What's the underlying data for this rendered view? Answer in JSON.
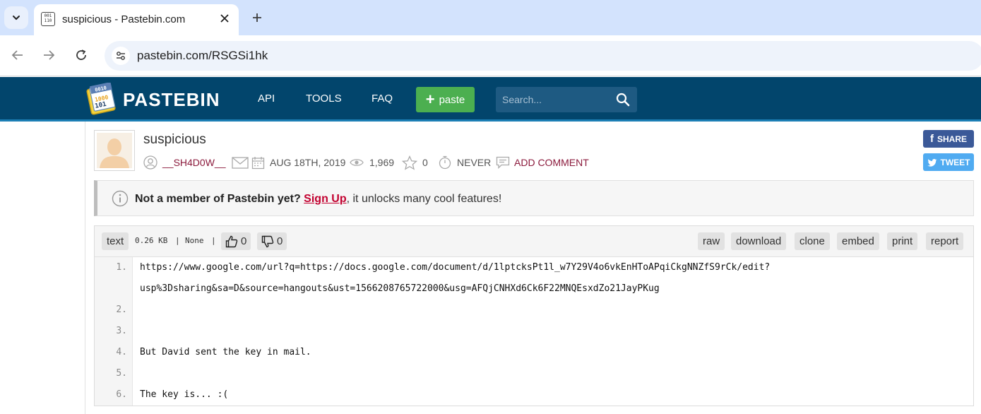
{
  "browser": {
    "tab_title": "suspicious - Pastebin.com",
    "url": "pastebin.com/RSGSi1hk"
  },
  "site": {
    "brand": "PASTEBIN",
    "nav": [
      "API",
      "TOOLS",
      "FAQ"
    ],
    "paste_button": "paste",
    "search_placeholder": "Search...",
    "header_color": "#02456c",
    "accent_green": "#4caf50"
  },
  "paste": {
    "title": "suspicious",
    "author": "__SH4D0W__",
    "date": "AUG 18TH, 2019",
    "views": "1,969",
    "stars": "0",
    "expiry": "NEVER",
    "add_comment": "ADD COMMENT",
    "share_facebook": "SHARE",
    "share_twitter": "TWEET"
  },
  "notice": {
    "lead": "Not a member of Pastebin yet?",
    "signup": "Sign Up",
    "tail": ", it unlocks many cool features!"
  },
  "code_header": {
    "syntax": "text",
    "size": "0.26 KB",
    "sep1": "|",
    "category": "None",
    "sep2": "|",
    "likes": "0",
    "dislikes": "0",
    "actions": [
      "raw",
      "download",
      "clone",
      "embed",
      "print",
      "report"
    ]
  },
  "code": {
    "lines": [
      {
        "num": "1.",
        "text": "https://www.google.com/url?q=https://docs.google.com/document/d/1lptcksPt1l_w7Y29V4o6vkEnHToAPqiCkgNNZfS9rCk/edit?",
        "wrap": "usp%3Dsharing&sa=D&source=hangouts&ust=1566208765722000&usg=AFQjCNHXd6Ck6F22MNQEsxdZo21JayPKug"
      },
      {
        "num": "2.",
        "text": ""
      },
      {
        "num": "3.",
        "text": ""
      },
      {
        "num": "4.",
        "text": "But David sent the key in mail."
      },
      {
        "num": "5.",
        "text": ""
      },
      {
        "num": "6.",
        "text": "The key is... :("
      }
    ]
  }
}
